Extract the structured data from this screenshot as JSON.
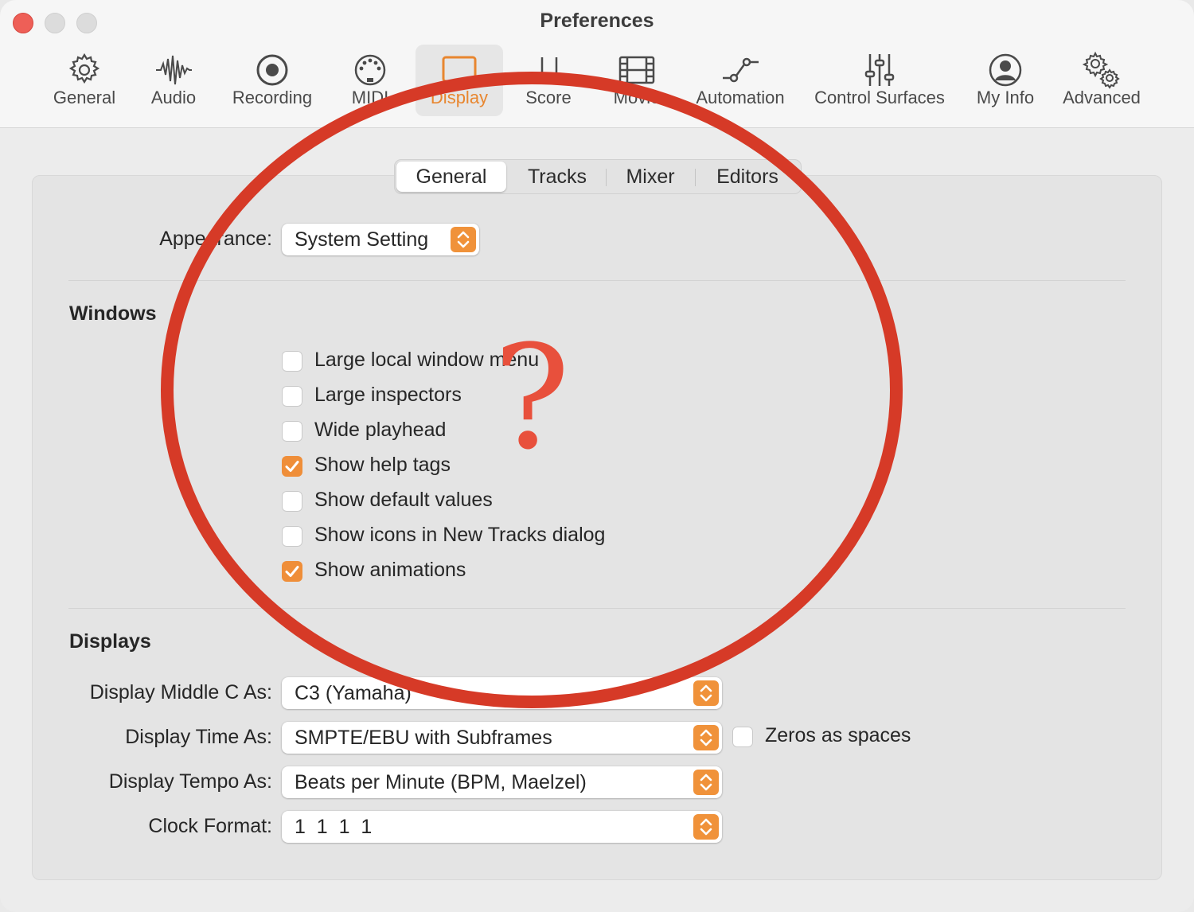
{
  "window": {
    "title": "Preferences"
  },
  "toolbar": {
    "items": [
      {
        "label": "General",
        "icon": "gear-icon"
      },
      {
        "label": "Audio",
        "icon": "waveform-icon"
      },
      {
        "label": "Recording",
        "icon": "record-icon"
      },
      {
        "label": "MIDI",
        "icon": "midi-port-icon"
      },
      {
        "label": "Display",
        "icon": "display-icon",
        "selected": true
      },
      {
        "label": "Score",
        "icon": "score-notes-icon"
      },
      {
        "label": "Movie",
        "icon": "film-icon"
      },
      {
        "label": "Automation",
        "icon": "automation-curve-icon"
      },
      {
        "label": "Control Surfaces",
        "icon": "faders-icon"
      },
      {
        "label": "My Info",
        "icon": "person-icon"
      },
      {
        "label": "Advanced",
        "icon": "gears-icon"
      }
    ]
  },
  "tabs": [
    {
      "label": "General",
      "active": true
    },
    {
      "label": "Tracks"
    },
    {
      "label": "Mixer"
    },
    {
      "label": "Editors"
    }
  ],
  "appearance": {
    "label": "Appearance:",
    "value": "System Setting"
  },
  "windows": {
    "heading": "Windows",
    "options": [
      {
        "label": "Large local window menu",
        "checked": false
      },
      {
        "label": "Large inspectors",
        "checked": false
      },
      {
        "label": "Wide playhead",
        "checked": false
      },
      {
        "label": "Show help tags",
        "checked": true
      },
      {
        "label": "Show default values",
        "checked": false
      },
      {
        "label": "Show icons in New Tracks dialog",
        "checked": false
      },
      {
        "label": "Show animations",
        "checked": true
      }
    ]
  },
  "displays": {
    "heading": "Displays",
    "middle_c": {
      "label": "Display Middle C As:",
      "value": "C3 (Yamaha)"
    },
    "time": {
      "label": "Display Time As:",
      "value": "SMPTE/EBU with Subframes"
    },
    "zeros": {
      "label": "Zeros as spaces",
      "checked": false
    },
    "tempo": {
      "label": "Display Tempo As:",
      "value": "Beats per Minute (BPM, Maelzel)"
    },
    "clock": {
      "label": "Clock Format:",
      "value": "1  1  1  1"
    }
  },
  "annotation": {
    "symbol": "?",
    "color": "#d63a27"
  },
  "colors": {
    "accent": "#ef8e39"
  }
}
